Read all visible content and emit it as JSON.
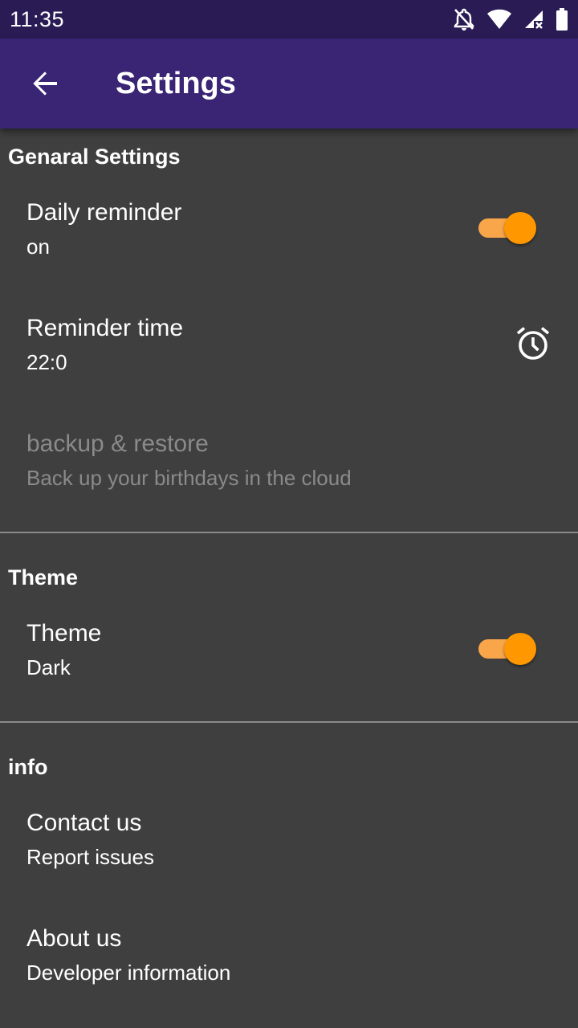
{
  "status_bar": {
    "time": "11:35",
    "icons": [
      "notifications-off-icon",
      "wifi-icon",
      "signal-no-service-icon",
      "battery-icon"
    ]
  },
  "app_bar": {
    "back_icon": "arrow-back-icon",
    "title": "Settings"
  },
  "sections": {
    "general": {
      "header": "Genaral Settings",
      "daily_reminder": {
        "title": "Daily reminder",
        "subtitle": "on",
        "toggle_on": true
      },
      "reminder_time": {
        "title": "Reminder time",
        "subtitle": "22:0",
        "icon": "alarm-icon"
      },
      "backup": {
        "title": "backup & restore",
        "subtitle": "Back up your birthdays in the cloud",
        "enabled": false
      }
    },
    "theme": {
      "header": "Theme",
      "theme_item": {
        "title": "Theme",
        "subtitle": "Dark",
        "toggle_on": true
      }
    },
    "info": {
      "header": "info",
      "contact": {
        "title": "Contact us",
        "subtitle": "Report issues"
      },
      "about": {
        "title": "About us",
        "subtitle": "Developer information"
      }
    }
  },
  "colors": {
    "status_bar": "#2a1b55",
    "app_bar": "#3a2474",
    "background": "#3f3f3f",
    "accent": "#ff9800",
    "accent_track": "#f9a64b",
    "disabled_text": "#8a8a8a"
  }
}
